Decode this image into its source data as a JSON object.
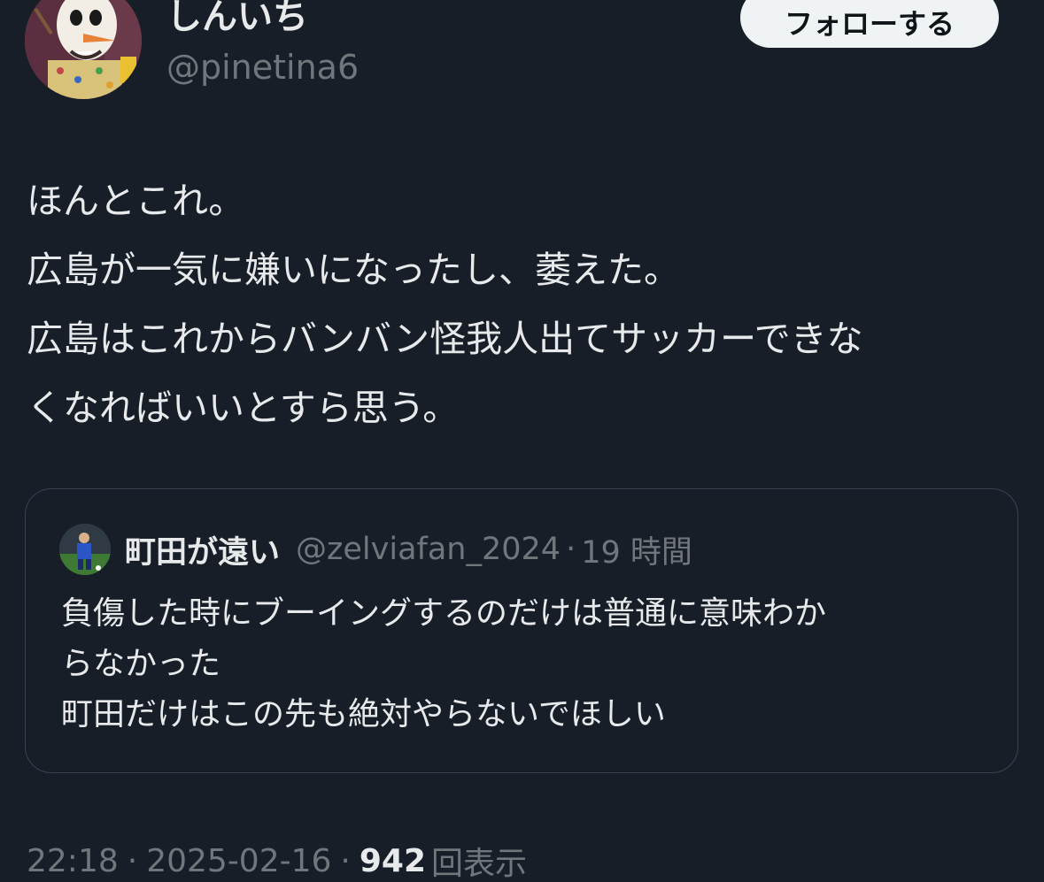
{
  "author": {
    "display_name": "しんいち",
    "handle": "@pinetina6"
  },
  "follow_button_label": "フォローする",
  "tweet": {
    "lines": [
      "ほんとこれ。",
      "広島が一気に嫌いになったし、萎えた。",
      "広島はこれからバンバン怪我人出てサッカーできな",
      "くなればいいとすら思う。"
    ]
  },
  "quote": {
    "display_name": "町田が遠い",
    "handle": "@zelviafan_2024",
    "separator": "·",
    "time": "19 時間",
    "lines": [
      "負傷した時にブーイングするのだけは普通に意味わか",
      "らなかった",
      "町田だけはこの先も絶対やらないでほしい"
    ]
  },
  "meta": {
    "time": "22:18",
    "separator": "·",
    "date": "2025-02-16",
    "views_count": "942",
    "views_label": "回表示"
  },
  "colors": {
    "background": "#171e28",
    "text_primary": "#e7e9ea",
    "text_secondary": "#71767b",
    "follow_button_bg": "#eff3f4",
    "border": "#3a4350"
  }
}
